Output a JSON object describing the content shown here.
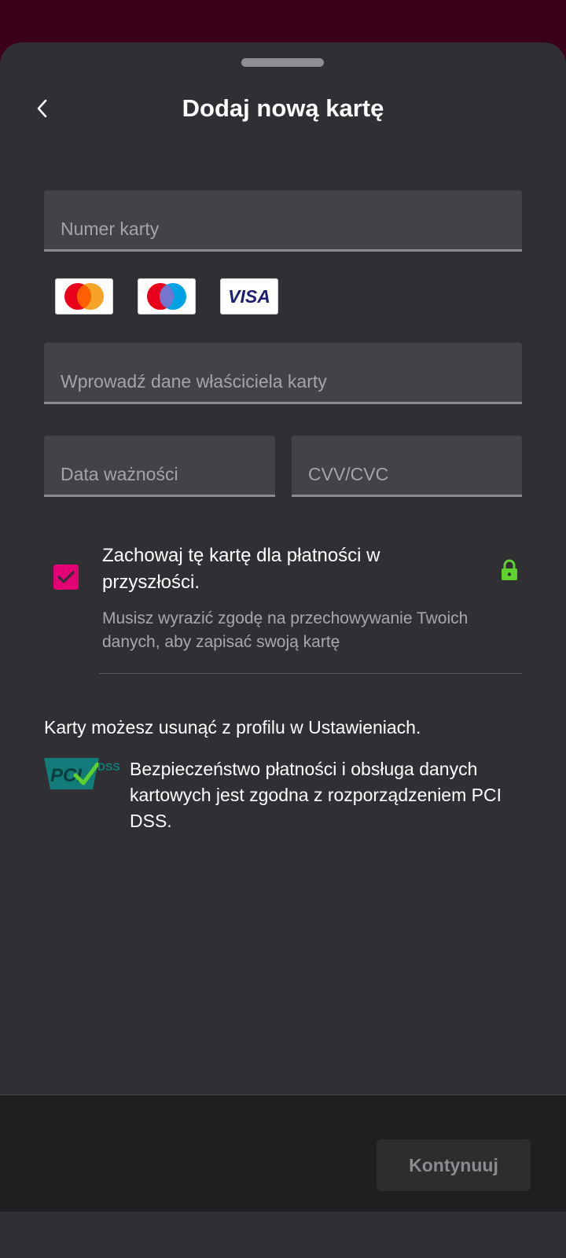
{
  "header": {
    "title": "Dodaj nową kartę",
    "back_icon": "chevron-left-icon"
  },
  "form": {
    "card_number_placeholder": "Numer karty",
    "cardholder_placeholder": "Wprowadź dane właściciela karty",
    "expiry_placeholder": "Data ważności",
    "cvv_placeholder": "CVV/CVC"
  },
  "card_brands": {
    "mastercard": "mastercard-logo",
    "maestro": "maestro-logo",
    "visa_label": "VISA"
  },
  "consent": {
    "checked": true,
    "title": "Zachowaj tę kartę dla płatności w przyszłości.",
    "subtitle": "Musisz wyrazić zgodę na przechowywanie Twoich danych, aby zapisać swoją kartę",
    "lock_icon": "lock-icon",
    "lock_color": "#5fd12e"
  },
  "info": {
    "remove_cards": "Karty możesz usunąć z profilu w Ustawieniach.",
    "pci_logo_text": "PCI",
    "pci_logo_dss": "DSS",
    "pci_text": "Bezpieczeństwo płatności i obsługa danych kartowych jest zgodna z rozporządzeniem PCI DSS."
  },
  "footer": {
    "continue_label": "Kontynuuj"
  },
  "colors": {
    "accent": "#e20074",
    "background": "#2f2f34",
    "top_bar": "#3a0018"
  }
}
